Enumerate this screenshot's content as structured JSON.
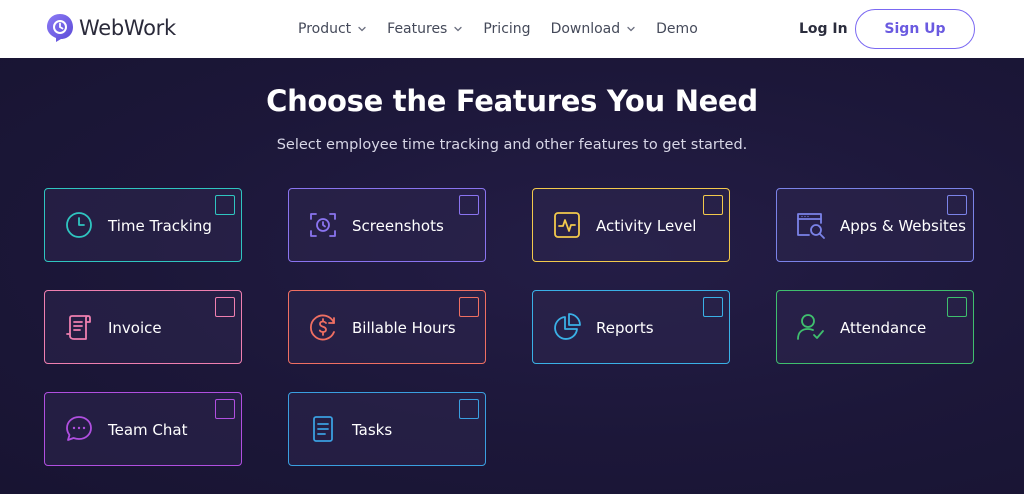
{
  "header": {
    "brand": "WebWork",
    "nav": [
      {
        "label": "Product",
        "dropdown": true
      },
      {
        "label": "Features",
        "dropdown": true
      },
      {
        "label": "Pricing",
        "dropdown": false
      },
      {
        "label": "Download",
        "dropdown": true
      },
      {
        "label": "Demo",
        "dropdown": false
      }
    ],
    "login_label": "Log In",
    "signup_label": "Sign Up"
  },
  "hero": {
    "title": "Choose the Features You Need",
    "subtitle": "Select employee time tracking and other features to get started."
  },
  "features": [
    {
      "label": "Time Tracking",
      "icon": "clock-icon",
      "color": "#2fc5c0",
      "checked": false
    },
    {
      "label": "Screenshots",
      "icon": "screenshot-icon",
      "color": "#8a74f0",
      "checked": false
    },
    {
      "label": "Activity Level",
      "icon": "activity-icon",
      "color": "#f2c94c",
      "checked": false
    },
    {
      "label": "Apps & Websites",
      "icon": "apps-websites-icon",
      "color": "#7b83e8",
      "checked": false
    },
    {
      "label": "Invoice",
      "icon": "invoice-icon",
      "color": "#ef7fb0",
      "checked": false
    },
    {
      "label": "Billable Hours",
      "icon": "billable-hours-icon",
      "color": "#ef6f62",
      "checked": false
    },
    {
      "label": "Reports",
      "icon": "reports-icon",
      "color": "#3ab0e6",
      "checked": false
    },
    {
      "label": "Attendance",
      "icon": "attendance-icon",
      "color": "#3fbf6e",
      "checked": false
    },
    {
      "label": "Team Chat",
      "icon": "chat-icon",
      "color": "#b04fe0",
      "checked": false
    },
    {
      "label": "Tasks",
      "icon": "tasks-icon",
      "color": "#3a9fe0",
      "checked": false
    }
  ],
  "colors": {
    "header_bg": "#ffffff",
    "hero_bg": "#1b1638",
    "brand_accent": "#7a68f2"
  }
}
